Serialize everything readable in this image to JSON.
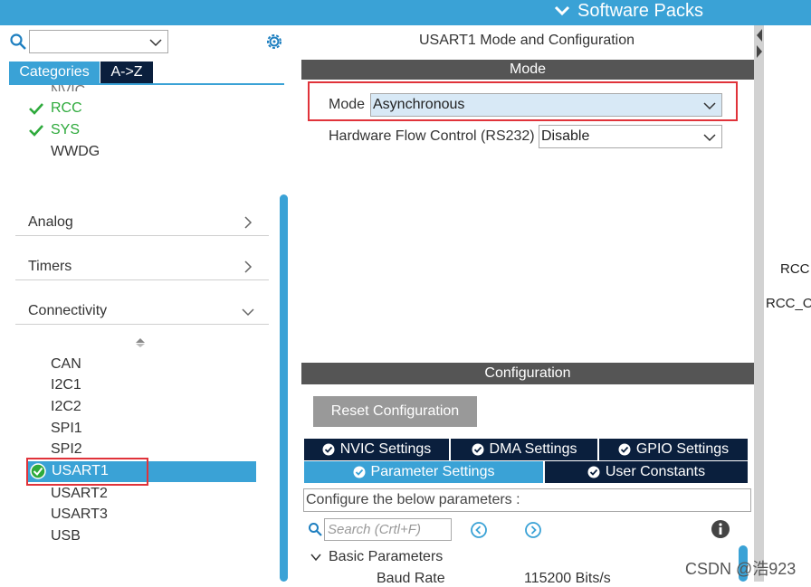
{
  "topbar": {
    "software_packs": "Software Packs",
    "accent": "#3aa2d6"
  },
  "left": {
    "tabs": {
      "categories": "Categories",
      "az": "A->Z"
    },
    "partial_item": "NVIC",
    "system_items": [
      {
        "label": "RCC",
        "checked": true
      },
      {
        "label": "SYS",
        "checked": true
      },
      {
        "label": "WWDG",
        "checked": false
      }
    ],
    "categories": [
      {
        "label": "Analog",
        "expanded": false
      },
      {
        "label": "Timers",
        "expanded": false
      },
      {
        "label": "Connectivity",
        "expanded": true
      }
    ],
    "connectivity_items": [
      "CAN",
      "I2C1",
      "I2C2",
      "SPI1",
      "SPI2",
      "USART1",
      "USART2",
      "USART3",
      "USB"
    ],
    "selected": "USART1"
  },
  "middle": {
    "title": "USART1 Mode and Configuration",
    "mode_header": "Mode",
    "mode_label": "Mode",
    "mode_value": "Asynchronous",
    "hw_label": "Hardware Flow Control (RS232)",
    "hw_value": "Disable",
    "config_header": "Configuration",
    "reset_button": "Reset Configuration",
    "settings_tabs": {
      "nvic": "NVIC Settings",
      "dma": "DMA Settings",
      "gpio": "GPIO Settings",
      "parameter": "Parameter Settings",
      "user_constants": "User Constants"
    },
    "configure_note": "Configure the below parameters :",
    "search_placeholder": "Search (Crtl+F)",
    "basic_params": "Basic Parameters",
    "baud_label": "Baud Rate",
    "baud_value": "115200 Bits/s"
  },
  "right": {
    "rcc1": "RCC",
    "rcc2": "RCC_O"
  },
  "watermark": "CSDN @浩923"
}
